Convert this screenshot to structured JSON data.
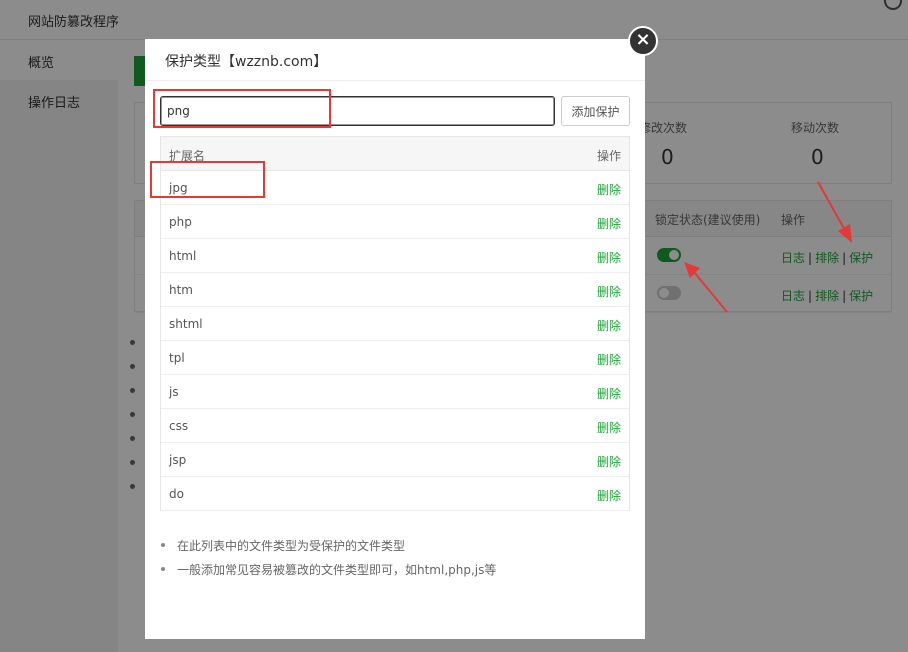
{
  "app": {
    "title": "网站防篡改程序",
    "sidebar": [
      "概览",
      "操作日志"
    ]
  },
  "stats": {
    "items": [
      {
        "label": "修改次数",
        "value": "0"
      },
      {
        "label": "移动次数",
        "value": "0"
      }
    ]
  },
  "site_table": {
    "headers": {
      "lock": "锁定状态(建议使用)",
      "ops": "操作"
    },
    "rows": [
      {
        "lock_on": true,
        "ops": [
          "日志",
          "排除",
          "保护"
        ]
      },
      {
        "lock_on": false,
        "ops": [
          "日志",
          "排除",
          "保护"
        ]
      }
    ]
  },
  "modal": {
    "title": "保护类型【wzznb.com】",
    "close_icon": "×",
    "input_value": "png",
    "add_button": "添加保护",
    "table_headers": {
      "name": "扩展名",
      "ops": "操作"
    },
    "delete_label": "删除",
    "extensions": [
      "jpg",
      "php",
      "html",
      "htm",
      "shtml",
      "tpl",
      "js",
      "css",
      "jsp",
      "do"
    ],
    "notes": [
      "在此列表中的文件类型为受保护的文件类型",
      "一般添加常见容易被篡改的文件类型即可，如html,php,js等"
    ]
  },
  "colors": {
    "accent": "#20a53a",
    "annotation": "#e53935"
  }
}
